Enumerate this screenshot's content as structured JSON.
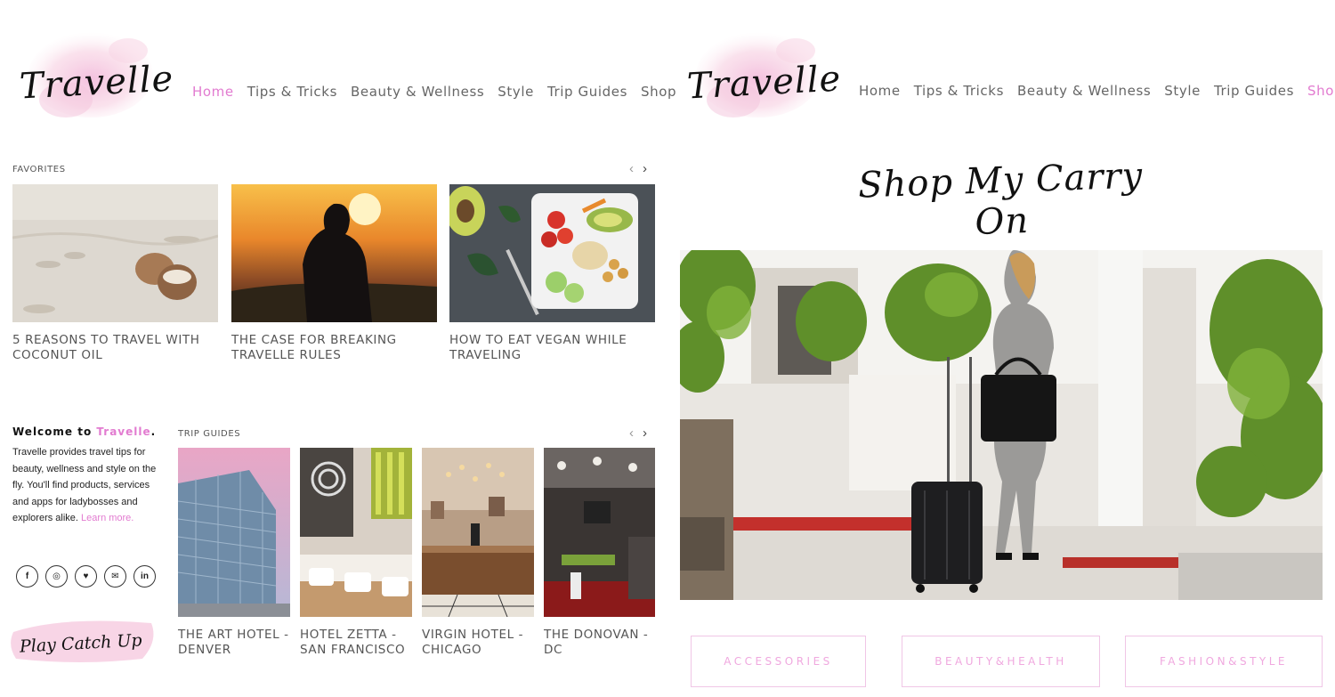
{
  "left": {
    "logo_text": "Travelle",
    "nav": [
      {
        "label": "Home",
        "active": true
      },
      {
        "label": "Tips & Tricks",
        "active": false
      },
      {
        "label": "Beauty & Wellness",
        "active": false
      },
      {
        "label": "Style",
        "active": false
      },
      {
        "label": "Trip Guides",
        "active": false
      },
      {
        "label": "Shop",
        "active": false
      }
    ],
    "favorites": {
      "label": "FAVORITES",
      "prev": "‹",
      "next": "›",
      "items": [
        {
          "title": "5 REASONS TO TRAVEL WITH COCONUT OIL"
        },
        {
          "title": "THE CASE FOR BREAKING TRAVELLE RULES"
        },
        {
          "title": "HOW TO EAT VEGAN WHILE TRAVELING"
        }
      ]
    },
    "welcome": {
      "heading_prefix": "Welcome to ",
      "heading_brand": "Travelle",
      "heading_suffix": ".",
      "body": "Travelle provides travel tips for beauty, wellness and style on the fly. You'll find products, services and apps for ladybosses and explorers alike.",
      "link": "Learn more."
    },
    "social": [
      {
        "icon": "facebook-icon",
        "glyph": "f"
      },
      {
        "icon": "instagram-icon",
        "glyph": "◎"
      },
      {
        "icon": "twitter-icon",
        "glyph": "♥"
      },
      {
        "icon": "email-icon",
        "glyph": "✉"
      },
      {
        "icon": "linkedin-icon",
        "glyph": "in"
      }
    ],
    "catchup": "Play Catch Up",
    "trip_guides": {
      "label": "TRIP GUIDES",
      "prev": "‹",
      "next": "›",
      "items": [
        {
          "title": "THE ART HOTEL - DENVER"
        },
        {
          "title": "HOTEL ZETTA - SAN FRANCISCO"
        },
        {
          "title": "VIRGIN HOTEL - CHICAGO"
        },
        {
          "title": "THE DONOVAN - DC"
        }
      ]
    }
  },
  "right": {
    "logo_text": "Travelle",
    "nav": [
      {
        "label": "Home",
        "active": false
      },
      {
        "label": "Tips & Tricks",
        "active": false
      },
      {
        "label": "Beauty & Wellness",
        "active": false
      },
      {
        "label": "Style",
        "active": false
      },
      {
        "label": "Trip Guides",
        "active": false
      },
      {
        "label": "Shop",
        "active": true
      }
    ],
    "heading": "Shop My Carry On",
    "categories": [
      "ACCESSORIES",
      "BEAUTY&HEALTH",
      "FASHION&STYLE"
    ]
  },
  "colors": {
    "accent": "#e27bd0",
    "category_text": "#f0a8df",
    "category_border": "#f0c6e6"
  }
}
